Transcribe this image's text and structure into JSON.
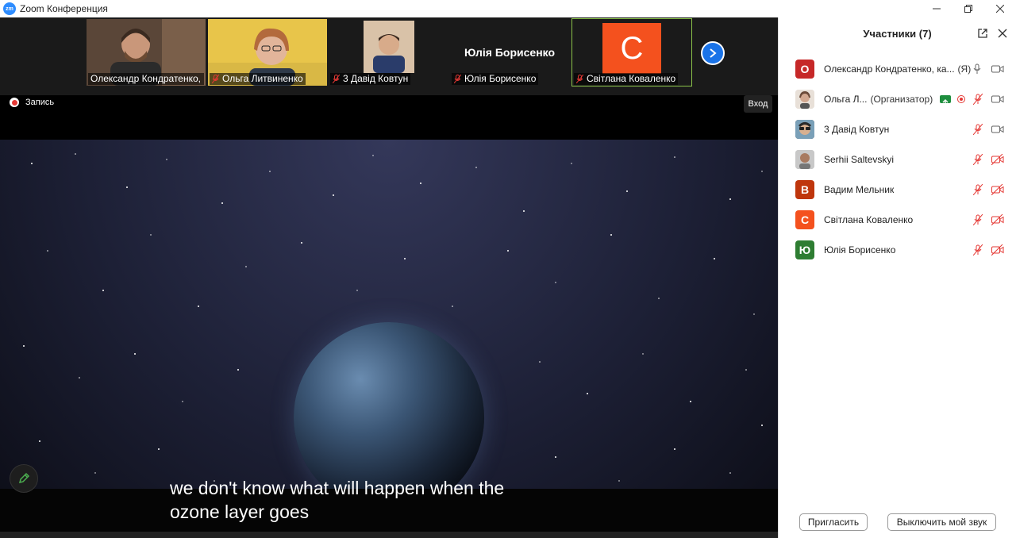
{
  "window": {
    "logo_text": "zm",
    "title": "Zoom Конференция"
  },
  "gallery": {
    "tiles": [
      {
        "label": "Олександр Кондратенко, ка..."
      },
      {
        "label": "Ольга Литвиненко"
      },
      {
        "label": "3 Давід Ковтун"
      },
      {
        "label": "Юлія Борисенко",
        "name_big": "Юлія Борисенко"
      },
      {
        "label": "Світлана Коваленко",
        "avatar_letter": "С"
      }
    ]
  },
  "recording": {
    "label": "Запись"
  },
  "enter_button": {
    "label": "Вход"
  },
  "caption": {
    "line1": "we don't know what will happen when the",
    "line2": "ozone layer goes"
  },
  "participants_panel": {
    "title": "Участники (7)",
    "participants": [
      {
        "avatar": "О",
        "name": "Олександр Кондратенко, ка...",
        "role": "(Я)"
      },
      {
        "avatar": "",
        "name": "Ольга Л...",
        "role": "(Организатор)"
      },
      {
        "avatar": "",
        "name": "3 Давід Ковтун",
        "role": ""
      },
      {
        "avatar": "",
        "name": "Serhii Saltevskyi",
        "role": ""
      },
      {
        "avatar": "В",
        "name": "Вадим Мельник",
        "role": ""
      },
      {
        "avatar": "С",
        "name": "Світлана Коваленко",
        "role": ""
      },
      {
        "avatar": "Ю",
        "name": "Юлія Борисенко",
        "role": ""
      }
    ],
    "invite_button": "Пригласить",
    "mute_button": "Выключить мой звук"
  },
  "colors": {
    "accent": "#2D8CFF",
    "muted_red": "#e53935",
    "avatar_o": "#c62828",
    "avatar_v": "#bf360c",
    "avatar_s": "#f4511e",
    "avatar_yu": "#2e7d32"
  }
}
